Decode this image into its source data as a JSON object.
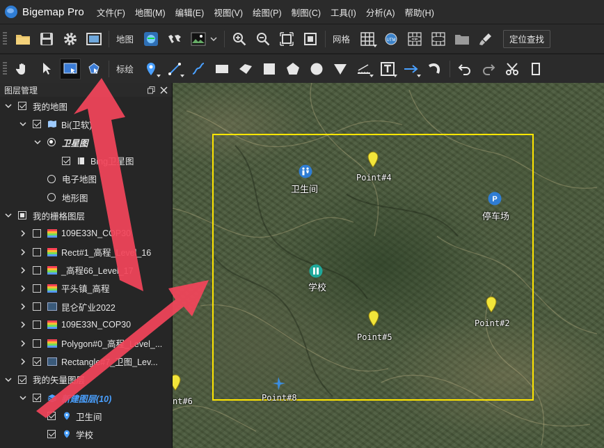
{
  "app": {
    "title": "Bigemap Pro"
  },
  "menu": [
    "文件(F)",
    "地图(M)",
    "编辑(E)",
    "视图(V)",
    "绘图(P)",
    "制图(C)",
    "工具(I)",
    "分析(A)",
    "帮助(H)"
  ],
  "toolbar1": {
    "map_label": "地图",
    "grid_label": "网格",
    "search_label": "定位查找"
  },
  "toolbar2": {
    "mark_label": "标绘"
  },
  "panel": {
    "title": "图层管理",
    "rows": [
      {
        "level": 0,
        "chev": "down",
        "check": "checked",
        "label": "我的地图"
      },
      {
        "level": 1,
        "chev": "down",
        "check": "checked",
        "icon": "map",
        "label": "Bi(卫软)"
      },
      {
        "level": 2,
        "chev": "down",
        "radio": "on",
        "label": "卫星图",
        "style": "italic-white"
      },
      {
        "level": 3,
        "check": "checked",
        "icon": "book",
        "label": "Bing卫星图"
      },
      {
        "level": 2,
        "radio": "off",
        "label": "电子地图"
      },
      {
        "level": 2,
        "radio": "off",
        "label": "地形图"
      },
      {
        "level": 0,
        "chev": "down",
        "check": "partial",
        "label": "我的栅格图层"
      },
      {
        "level": 1,
        "chev": "right",
        "check": "none",
        "icon": "rainbow",
        "label": "109E33N_COP30"
      },
      {
        "level": 1,
        "chev": "right",
        "check": "none",
        "icon": "rainbow",
        "label": "Rect#1_高程_Level_16"
      },
      {
        "level": 1,
        "chev": "right",
        "check": "none",
        "icon": "rainbow",
        "label": "_高程66_Level_17"
      },
      {
        "level": 1,
        "chev": "right",
        "check": "none",
        "icon": "rainbow",
        "label": "平头镇_高程"
      },
      {
        "level": 1,
        "chev": "right",
        "check": "none",
        "icon": "image",
        "label": "昆仑矿业2022"
      },
      {
        "level": 1,
        "chev": "right",
        "check": "none",
        "icon": "rainbow",
        "label": "109E33N_COP30"
      },
      {
        "level": 1,
        "chev": "right",
        "check": "none",
        "icon": "rainbow",
        "label": "Polygon#0_高程_Level_..."
      },
      {
        "level": 1,
        "chev": "right",
        "check": "checked",
        "icon": "image",
        "label": "Rectangle#7_卫图_Lev..."
      },
      {
        "level": 0,
        "chev": "down",
        "check": "checked",
        "label": "我的矢量图层"
      },
      {
        "level": 1,
        "chev": "down",
        "check": "checked",
        "icon": "layers",
        "label": "新建图层(10)",
        "style": "italic-blue"
      },
      {
        "level": 2,
        "check": "checked",
        "icon": "pin",
        "label": "卫生间"
      },
      {
        "level": 2,
        "check": "checked",
        "icon": "pin",
        "label": "学校"
      }
    ]
  },
  "map": {
    "markers": [
      {
        "name": "point-4-marker",
        "label": "Point#4"
      },
      {
        "name": "point-2-marker",
        "label": "Point#2"
      },
      {
        "name": "point-5-marker",
        "label": "Point#5"
      },
      {
        "name": "point-8-marker",
        "label": "Point#8"
      },
      {
        "name": "point-6-marker",
        "label": "nt#6"
      }
    ],
    "pois": [
      {
        "name": "toilet-poi",
        "label": "卫生间"
      },
      {
        "name": "parking-poi",
        "label": "停车场"
      },
      {
        "name": "school-poi",
        "label": "学校"
      }
    ]
  },
  "colors": {
    "selection": "#ffe600",
    "accent": "#2f7dd4",
    "arrow": "#f2455a"
  }
}
